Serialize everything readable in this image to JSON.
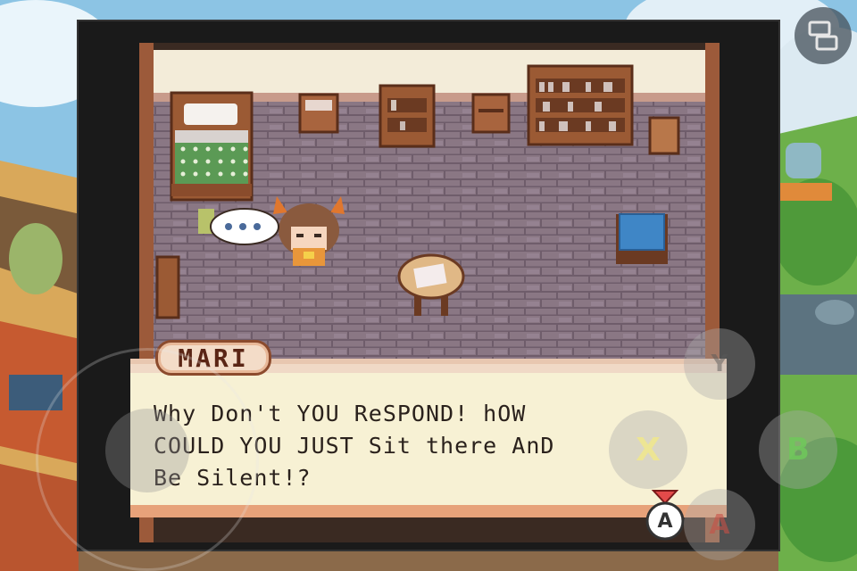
{
  "dialogue": {
    "speaker": "MARI",
    "lines": [
      "Why Don't YOU ReSPOND! hOW",
      "COULD YOU JUST Sit there AnD",
      "Be Silent!?"
    ],
    "advance_prompt": "A"
  },
  "speech_bubble": {
    "text": "●●●"
  },
  "controls": {
    "x_label": "X",
    "b_label": "B",
    "y_label": "Y",
    "a_label": "A"
  },
  "icons": {
    "screen_toggle": "swap-screens-icon",
    "advance": "a-button-prompt-icon"
  },
  "colors": {
    "floor": "#8a7784",
    "wall": "#f3ecd9",
    "dialog_bg": "#f7f1d4",
    "name_plate": "#f3dcc8"
  }
}
